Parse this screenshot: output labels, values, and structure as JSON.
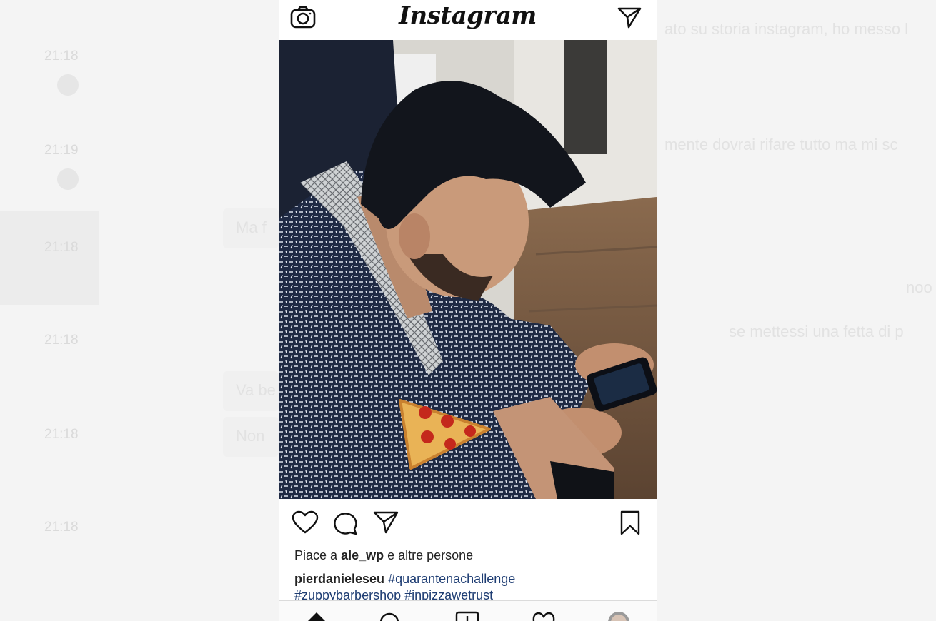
{
  "instagram": {
    "logo": "Instagram",
    "header_icons": [
      "camera-icon",
      "direct-send-icon"
    ],
    "post": {
      "liked_by_prefix": "Piace a",
      "liked_by_user": "ale_wp",
      "liked_by_suffix": "e altre persone",
      "author": "pierdanieleseu",
      "hashtags": [
        "#quarantenachallenge",
        "#zuppybarbershop",
        "#inpizzawetrust"
      ]
    },
    "action_icons": [
      "heart-icon",
      "comment-icon",
      "share-icon",
      "bookmark-icon"
    ],
    "bottom_nav_icons": [
      "home-icon",
      "search-icon",
      "add-post-icon",
      "activity-heart-icon",
      "profile-avatar"
    ]
  },
  "background_chat": {
    "times": [
      "21:18",
      "21:19",
      "21:18",
      "21:18",
      "21:18",
      "21:18"
    ],
    "messages": [
      "ato su storia instagram, ho messo l",
      "mente dovrai rifare tutto ma mi sc",
      "Ma f",
      "noo",
      "se mettessi una fetta di p",
      "Va be",
      "Non"
    ]
  },
  "colors": {
    "hashtag": "#1e3d73",
    "text": "#222222",
    "background": "#f4f4f4"
  }
}
